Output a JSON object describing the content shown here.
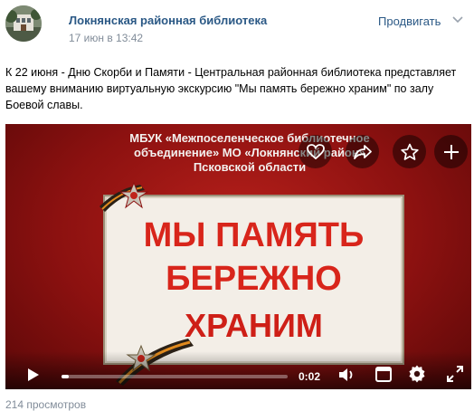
{
  "post": {
    "group_name": "Локнянская районная библиотека",
    "time": "17 июн в 13:42",
    "promote_label": "Продвигать",
    "text": "К 22 июня - Дню Скорби и Памяти - Центральная районная библиотека представляет вашему вниманию виртуальную экскурсию \"Мы память бережно храним\" по залу Боевой славы.",
    "views": "214 просмотров"
  },
  "video": {
    "header_lines": [
      "МБУК «Межпоселенческое библиотечное",
      "объединение» МО «Локнянский район»",
      "Псковской области"
    ],
    "title_lines": [
      "МЫ ПАМЯТЬ",
      "БЕРЕЖНО",
      "ХРАНИМ"
    ],
    "timecode": "0:02",
    "progress": 0.03,
    "overlay_icons": [
      "heart-icon",
      "share-icon",
      "star-icon",
      "plus-icon"
    ],
    "control_icons": [
      "play-icon",
      "volume-icon",
      "miniplayer-icon",
      "settings-icon",
      "fullscreen-icon"
    ]
  },
  "colors": {
    "link": "#2a5885",
    "secondary": "#818c99",
    "video_red": "#b8201b",
    "title_red": "#d8251b"
  }
}
